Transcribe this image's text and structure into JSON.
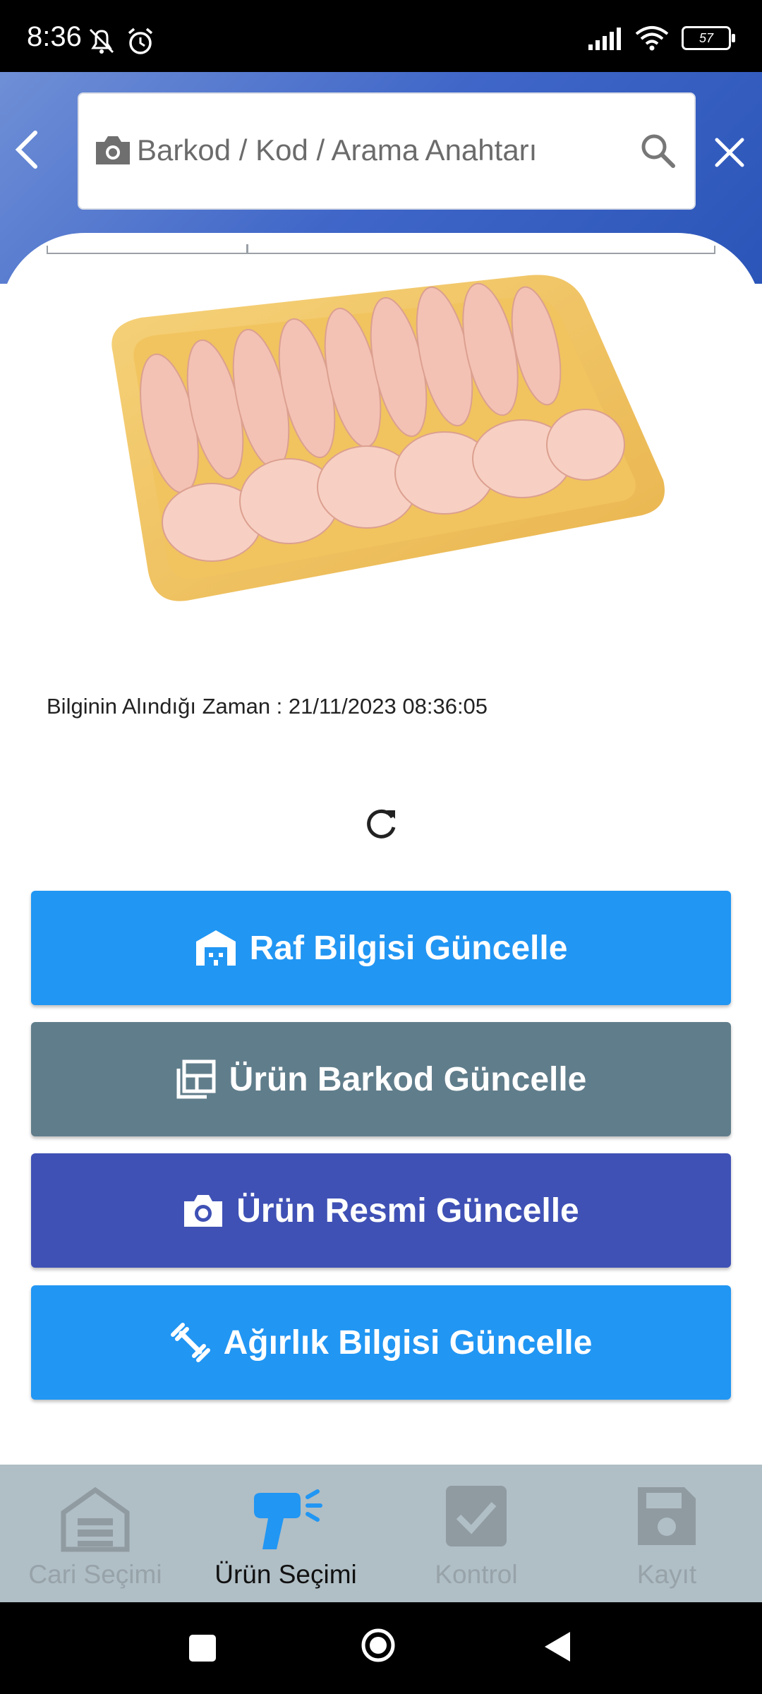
{
  "status_bar": {
    "time": "8:36",
    "battery": "57"
  },
  "search": {
    "placeholder": "Barkod / Kod / Arama Anahtarı"
  },
  "product": {
    "info_time_label": "Bilginin Alındığı Zaman : 21/11/2023 08:36:05"
  },
  "actions": [
    {
      "label": "Raf Bilgisi Güncelle",
      "icon": "warehouse-icon",
      "color": "#2196f3"
    },
    {
      "label": "Ürün Barkod Güncelle",
      "icon": "dashboard-icon",
      "color": "#607d8b"
    },
    {
      "label": "Ürün Resmi Güncelle",
      "icon": "camera-icon",
      "color": "#3f51b5"
    },
    {
      "label": "Ağırlık Bilgisi Güncelle",
      "icon": "dumbbell-icon",
      "color": "#2196f3"
    }
  ],
  "bottom_nav": {
    "items": [
      {
        "label": "Cari Seçimi",
        "icon": "house-icon",
        "active": false
      },
      {
        "label": "Ürün Seçimi",
        "icon": "barcode-scanner-icon",
        "active": true
      },
      {
        "label": "Kontrol",
        "icon": "checkbox-icon",
        "active": false
      },
      {
        "label": "Kayıt",
        "icon": "save-icon",
        "active": false
      }
    ]
  },
  "colors": {
    "header_gradient": [
      "#6f8fd6",
      "#2b55b8"
    ],
    "nav_background": "#b0bec5",
    "active_nav_icon": "#2196f3"
  }
}
